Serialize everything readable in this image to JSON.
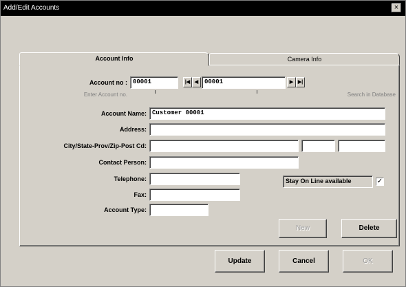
{
  "window": {
    "title": "Add/Edit Accounts",
    "close_glyph": "×"
  },
  "tabs": [
    {
      "label": "Account Info",
      "active": true
    },
    {
      "label": "Camera Info",
      "active": false
    }
  ],
  "form": {
    "account_no_label": "Account no :",
    "account_no_value": "00001",
    "enter_account_caption": "Enter Account no.",
    "nav_value": "00001",
    "nav_first": "|◀",
    "nav_prev": "◀",
    "nav_next": "▶",
    "nav_last": "▶|",
    "search_caption": "Search in Database",
    "account_name_label": "Account Name:",
    "account_name_value": "Customer 00001",
    "address_label": "Address:",
    "address_value": "",
    "city_label": "City/State-Prov/Zip-Post Cd:",
    "city_value": "",
    "state_value": "",
    "zip_value": "",
    "contact_label": "Contact Person:",
    "contact_value": "",
    "telephone_label": "Telephone:",
    "telephone_value": "",
    "fax_label": "Fax:",
    "fax_value": "",
    "account_type_label": "Account Type:",
    "account_type_value": "",
    "stay_online_label": "Stay On Line available",
    "stay_online_checked": "✓"
  },
  "buttons": {
    "new": "New",
    "delete": "Delete",
    "update": "Update",
    "cancel": "Cancel",
    "ok": "OK"
  },
  "colors": {
    "face": "#d4d0c8",
    "titlebar": "#000000",
    "field": "#ffffff"
  }
}
